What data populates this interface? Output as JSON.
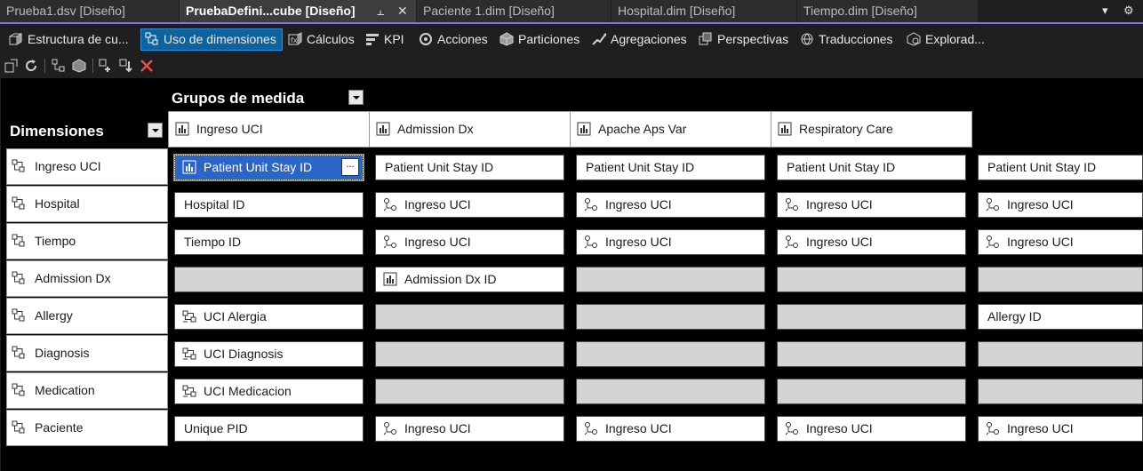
{
  "tabs": [
    {
      "label": "Prueba1.dsv [Diseño]"
    },
    {
      "label": "PruebaDefini...cube [Diseño]"
    },
    {
      "label": "Paciente 1.dim [Diseño]"
    },
    {
      "label": "Hospital.dim [Diseño]"
    },
    {
      "label": "Tiempo.dim [Diseño]"
    }
  ],
  "designer_tabs": [
    {
      "label": "Estructura de cu...",
      "icon": "cube-structure-icon"
    },
    {
      "label": "Uso de dimensiones",
      "icon": "dimension-usage-icon"
    },
    {
      "label": "Cálculos",
      "icon": "calculations-icon"
    },
    {
      "label": "KPI",
      "icon": "kpi-icon"
    },
    {
      "label": "Acciones",
      "icon": "actions-icon"
    },
    {
      "label": "Particiones",
      "icon": "partitions-icon"
    },
    {
      "label": "Agregaciones",
      "icon": "aggregations-icon"
    },
    {
      "label": "Perspectivas",
      "icon": "perspectives-icon"
    },
    {
      "label": "Traducciones",
      "icon": "translations-icon"
    },
    {
      "label": "Explorad...",
      "icon": "browser-icon"
    }
  ],
  "grid": {
    "measure_groups_label": "Grupos de medida",
    "dimensions_label": "Dimensiones",
    "measure_groups": [
      "Ingreso UCI",
      "Admission Dx",
      "Apache Aps Var",
      "Respiratory Care"
    ],
    "rows": [
      {
        "dimension": "Ingreso UCI",
        "cells": [
          {
            "text": "Patient Unit Stay ID",
            "kind": "fact"
          },
          {
            "text": "Patient Unit Stay ID",
            "kind": "plain"
          },
          {
            "text": "Patient Unit Stay ID",
            "kind": "plain"
          },
          {
            "text": "Patient Unit Stay ID",
            "kind": "plain"
          },
          {
            "text": "Patient Unit Stay ID",
            "kind": "plain"
          }
        ]
      },
      {
        "dimension": "Hospital",
        "cells": [
          {
            "text": "Hospital ID",
            "kind": "plain"
          },
          {
            "text": "Ingreso UCI",
            "kind": "ref"
          },
          {
            "text": "Ingreso UCI",
            "kind": "ref"
          },
          {
            "text": "Ingreso UCI",
            "kind": "ref"
          },
          {
            "text": "Ingreso UCI",
            "kind": "ref"
          }
        ]
      },
      {
        "dimension": "Tiempo",
        "cells": [
          {
            "text": "Tiempo ID",
            "kind": "plain"
          },
          {
            "text": "Ingreso UCI",
            "kind": "ref"
          },
          {
            "text": "Ingreso UCI",
            "kind": "ref"
          },
          {
            "text": "Ingreso UCI",
            "kind": "ref"
          },
          {
            "text": "Ingreso UCI",
            "kind": "ref"
          }
        ]
      },
      {
        "dimension": "Admission Dx",
        "cells": [
          {
            "text": "",
            "kind": "empty"
          },
          {
            "text": "Admission Dx ID",
            "kind": "fact"
          },
          {
            "text": "",
            "kind": "empty"
          },
          {
            "text": "",
            "kind": "empty"
          },
          {
            "text": "",
            "kind": "empty"
          }
        ]
      },
      {
        "dimension": "Allergy",
        "cells": [
          {
            "text": "UCI Alergia",
            "kind": "m2m"
          },
          {
            "text": "",
            "kind": "empty"
          },
          {
            "text": "",
            "kind": "empty"
          },
          {
            "text": "",
            "kind": "empty"
          },
          {
            "text": "Allergy ID",
            "kind": "plain"
          }
        ]
      },
      {
        "dimension": "Diagnosis",
        "cells": [
          {
            "text": "UCI Diagnosis",
            "kind": "m2m"
          },
          {
            "text": "",
            "kind": "empty"
          },
          {
            "text": "",
            "kind": "empty"
          },
          {
            "text": "",
            "kind": "empty"
          },
          {
            "text": "",
            "kind": "empty"
          }
        ]
      },
      {
        "dimension": "Medication",
        "cells": [
          {
            "text": "UCI Medicacion",
            "kind": "m2m"
          },
          {
            "text": "",
            "kind": "empty"
          },
          {
            "text": "",
            "kind": "empty"
          },
          {
            "text": "",
            "kind": "empty"
          },
          {
            "text": "",
            "kind": "empty"
          }
        ]
      },
      {
        "dimension": "Paciente",
        "cells": [
          {
            "text": "Unique PID",
            "kind": "plain"
          },
          {
            "text": "Ingreso UCI",
            "kind": "ref"
          },
          {
            "text": "Ingreso UCI",
            "kind": "ref"
          },
          {
            "text": "Ingreso UCI",
            "kind": "ref"
          },
          {
            "text": "Ingreso UCI",
            "kind": "ref"
          }
        ]
      }
    ],
    "selected_cell_button": "..."
  },
  "colors": {
    "accent": "#8a6fe0",
    "selection": "#2a65c8",
    "empty_cell": "#d4d4d4"
  }
}
